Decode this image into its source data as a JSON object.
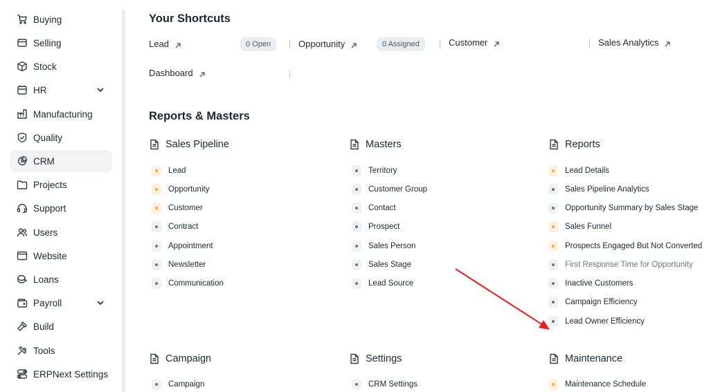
{
  "sidebar": {
    "items": [
      {
        "label": "Buying",
        "icon": "cart-icon"
      },
      {
        "label": "Selling",
        "icon": "receipt-icon"
      },
      {
        "label": "Stock",
        "icon": "box-icon"
      },
      {
        "label": "HR",
        "icon": "hr-icon",
        "expandable": true
      },
      {
        "label": "Manufacturing",
        "icon": "factory-icon"
      },
      {
        "label": "Quality",
        "icon": "shield-icon"
      },
      {
        "label": "CRM",
        "icon": "pie-chart-icon",
        "active": true
      },
      {
        "label": "Projects",
        "icon": "folder-icon"
      },
      {
        "label": "Support",
        "icon": "headset-icon"
      },
      {
        "label": "Users",
        "icon": "users-icon"
      },
      {
        "label": "Website",
        "icon": "browser-icon"
      },
      {
        "label": "Loans",
        "icon": "coins-icon"
      },
      {
        "label": "Payroll",
        "icon": "wallet-icon",
        "expandable": true
      },
      {
        "label": "Build",
        "icon": "hammer-icon"
      },
      {
        "label": "Tools",
        "icon": "tools-icon"
      },
      {
        "label": "ERPNext Settings",
        "icon": "toggle-icon"
      }
    ]
  },
  "shortcuts": {
    "title": "Your Shortcuts",
    "items": [
      {
        "label": "Lead",
        "badge": "0 Open"
      },
      {
        "label": "Opportunity",
        "badge": "0 Assigned"
      },
      {
        "label": "Customer"
      },
      {
        "label": "Sales Analytics"
      },
      {
        "label": "Dashboard"
      }
    ]
  },
  "reports_masters": {
    "title": "Reports & Masters",
    "cards": [
      {
        "title": "Sales Pipeline",
        "links": [
          {
            "label": "Lead",
            "warm": true
          },
          {
            "label": "Opportunity",
            "warm": true
          },
          {
            "label": "Customer",
            "warm": true
          },
          {
            "label": "Contract"
          },
          {
            "label": "Appointment"
          },
          {
            "label": "Newsletter"
          },
          {
            "label": "Communication"
          }
        ]
      },
      {
        "title": "Masters",
        "links": [
          {
            "label": "Territory"
          },
          {
            "label": "Customer Group"
          },
          {
            "label": "Contact"
          },
          {
            "label": "Prospect"
          },
          {
            "label": "Sales Person"
          },
          {
            "label": "Sales Stage"
          },
          {
            "label": "Lead Source"
          }
        ]
      },
      {
        "title": "Reports",
        "links": [
          {
            "label": "Lead Details",
            "warm": true
          },
          {
            "label": "Sales Pipeline Analytics"
          },
          {
            "label": "Opportunity Summary by Sales Stage"
          },
          {
            "label": "Sales Funnel",
            "warm": true
          },
          {
            "label": "Prospects Engaged But Not Converted",
            "warm": true
          },
          {
            "label": "First Response Time for Opportunity",
            "muted": true
          },
          {
            "label": "Inactive Customers"
          },
          {
            "label": "Campaign Efficiency"
          },
          {
            "label": "Lead Owner Efficiency"
          }
        ]
      },
      {
        "title": "Campaign",
        "links": [
          {
            "label": "Campaign"
          }
        ]
      },
      {
        "title": "Settings",
        "links": [
          {
            "label": "CRM Settings"
          }
        ]
      },
      {
        "title": "Maintenance",
        "links": [
          {
            "label": "Maintenance Schedule",
            "warm": true
          }
        ]
      }
    ]
  },
  "colors": {
    "accent_arrow": "#e8201c",
    "warm_dot": "#f2a93b",
    "active_bg": "#f3f3f3"
  }
}
